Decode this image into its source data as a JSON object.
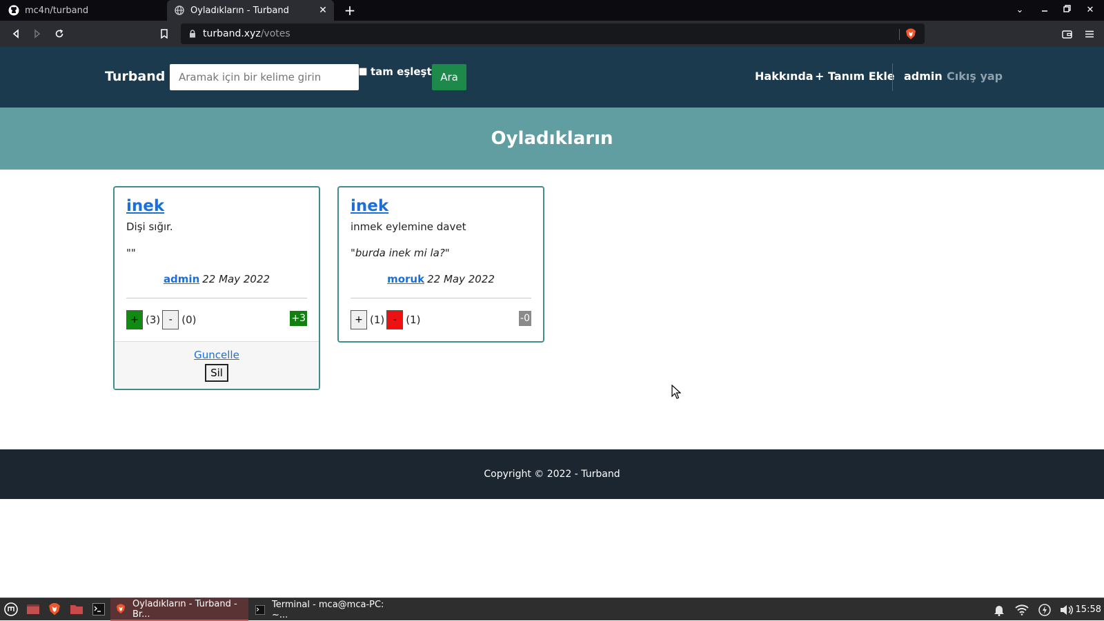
{
  "browser": {
    "tabs": [
      {
        "title": "mc4n/turband",
        "icon": "github-icon"
      },
      {
        "title": "Oyladıkların - Turband",
        "icon": "globe-icon"
      }
    ],
    "url_host": "turband.xyz",
    "url_path": "/votes"
  },
  "site": {
    "brand": "Turband",
    "search_placeholder": "Aramak için bir kelime girin",
    "exact_match_label": "tam eşleştir",
    "search_button": "Ara",
    "nav": {
      "about": "Hakkında",
      "add_definition": "+ Tanım Ekle",
      "user": "admin",
      "logout": "Cıkış yap"
    },
    "page_title": "Oyladıkların",
    "footer": "Copyright © 2022 - Turband"
  },
  "cards": [
    {
      "word": "inek",
      "definition": "Dişi sığır.",
      "example": "\"\"",
      "author": "admin",
      "date": "22 May 2022",
      "upvote_label": "+",
      "upvotes": "(3)",
      "downvote_label": "-",
      "downvotes": "(0)",
      "score": "+3",
      "update_label": "Guncelle",
      "delete_label": "Sil"
    },
    {
      "word": "inek",
      "definition": "inmek eylemine davet",
      "example": "\"burda inek mi la?\"",
      "author": "moruk",
      "date": "22 May 2022",
      "upvote_label": "+",
      "upvotes": "(1)",
      "downvote_label": "-",
      "downvotes": "(1)",
      "score": "-0"
    }
  ],
  "taskbar": {
    "tasks": [
      "Oyladıkların - Turband - Br...",
      "Terminal - mca@mca-PC: ~..."
    ],
    "clock": "15:58"
  },
  "colors": {
    "nav_bg": "#1b3a4d",
    "hero_bg": "#619ea1",
    "search_button": "#1d8a4b",
    "card_border": "#3f8c8e",
    "footer_bg": "#1b2631"
  }
}
